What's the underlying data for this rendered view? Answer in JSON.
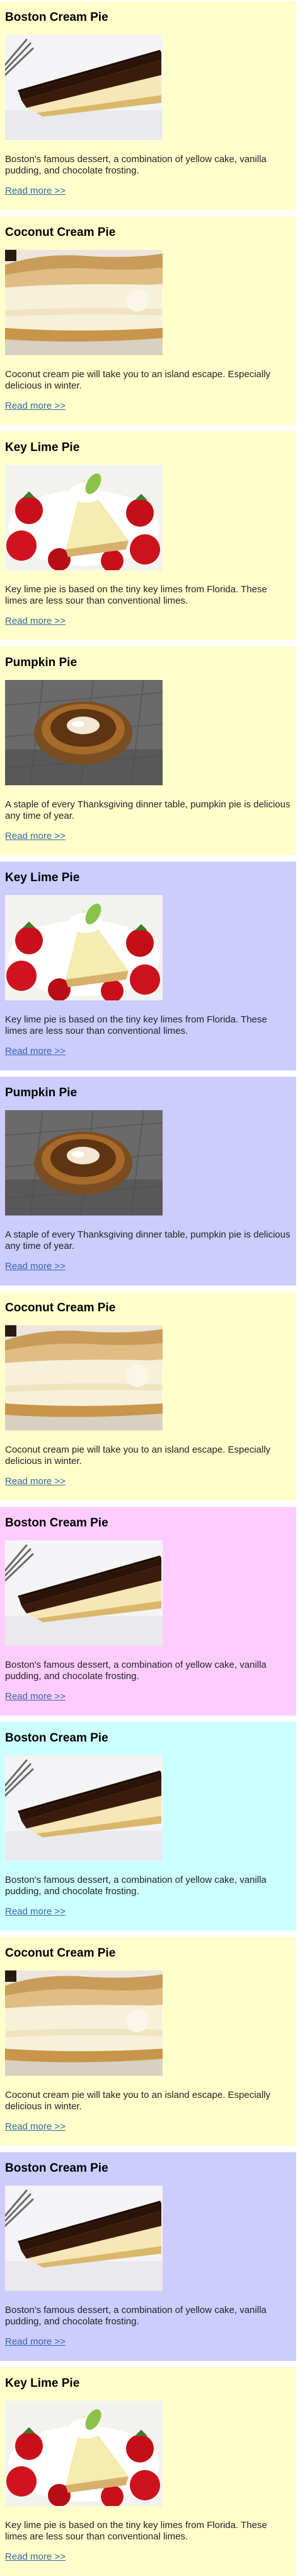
{
  "link_label": "Read more >>",
  "pies": {
    "boston": {
      "title": "Boston Cream Pie",
      "description": "Boston's famous dessert, a combination of yellow cake, vanilla pudding, and chocolate frosting."
    },
    "coconut": {
      "title": "Coconut Cream Pie",
      "description": "Coconut cream pie will take you to an island escape. Especially delicious in winter."
    },
    "keylime": {
      "title": "Key Lime Pie",
      "description": "Key lime pie is based on the tiny key limes from Florida. These limes are less sour than conventional limes."
    },
    "pumpkin": {
      "title": "Pumpkin Pie",
      "description": "A staple of every Thanksgiving dinner table, pumpkin pie is delicious any time of year."
    }
  },
  "cards": [
    {
      "pie": "boston",
      "bg": "#ffffcc"
    },
    {
      "pie": "coconut",
      "bg": "#ffffcc"
    },
    {
      "pie": "keylime",
      "bg": "#ffffcc"
    },
    {
      "pie": "pumpkin",
      "bg": "#ffffcc"
    },
    {
      "pie": "keylime",
      "bg": "#ccccff"
    },
    {
      "pie": "pumpkin",
      "bg": "#ccccff"
    },
    {
      "pie": "coconut",
      "bg": "#ffffcc"
    },
    {
      "pie": "boston",
      "bg": "#ffccff"
    },
    {
      "pie": "boston",
      "bg": "#ccffff"
    },
    {
      "pie": "coconut",
      "bg": "#ffffcc"
    },
    {
      "pie": "boston",
      "bg": "#ccccff"
    },
    {
      "pie": "keylime",
      "bg": "#ffffcc"
    }
  ]
}
